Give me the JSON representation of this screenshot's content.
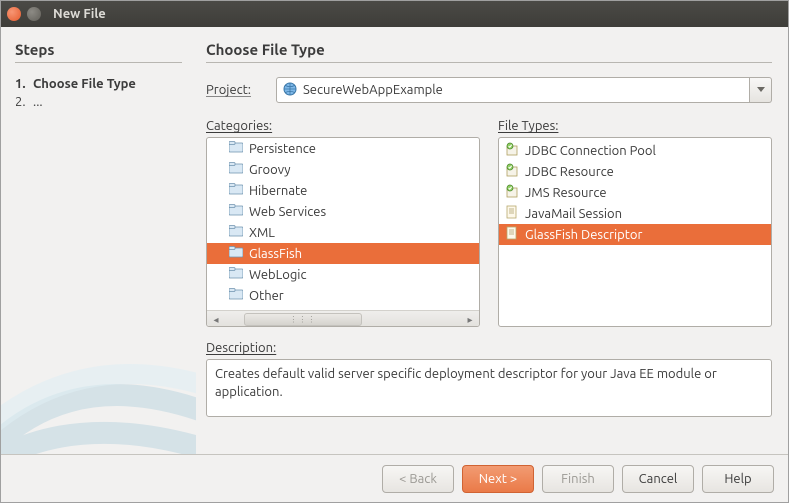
{
  "window": {
    "title": "New File"
  },
  "sidebar": {
    "heading": "Steps",
    "steps": [
      {
        "num": "1.",
        "label": "Choose File Type",
        "current": true
      },
      {
        "num": "2.",
        "label": "...",
        "current": false
      }
    ]
  },
  "main": {
    "heading": "Choose File Type",
    "project_label": "Project:",
    "project_value": "SecureWebAppExample",
    "categories_label": "Categories:",
    "filetypes_label": "File Types:",
    "categories": [
      {
        "label": "Persistence",
        "selected": false
      },
      {
        "label": "Groovy",
        "selected": false
      },
      {
        "label": "Hibernate",
        "selected": false
      },
      {
        "label": "Web Services",
        "selected": false
      },
      {
        "label": "XML",
        "selected": false
      },
      {
        "label": "GlassFish",
        "selected": true
      },
      {
        "label": "WebLogic",
        "selected": false
      },
      {
        "label": "Other",
        "selected": false
      }
    ],
    "filetypes": [
      {
        "label": "JDBC Connection Pool",
        "icon": "resource",
        "selected": false
      },
      {
        "label": "JDBC Resource",
        "icon": "resource",
        "selected": false
      },
      {
        "label": "JMS Resource",
        "icon": "resource",
        "selected": false
      },
      {
        "label": "JavaMail Session",
        "icon": "doc",
        "selected": false
      },
      {
        "label": "GlassFish Descriptor",
        "icon": "doc",
        "selected": true
      }
    ],
    "description_label": "Description:",
    "description_text": "Creates default valid server specific deployment descriptor for your Java EE module or application."
  },
  "footer": {
    "back": "< Back",
    "next": "Next >",
    "finish": "Finish",
    "cancel": "Cancel",
    "help": "Help"
  }
}
